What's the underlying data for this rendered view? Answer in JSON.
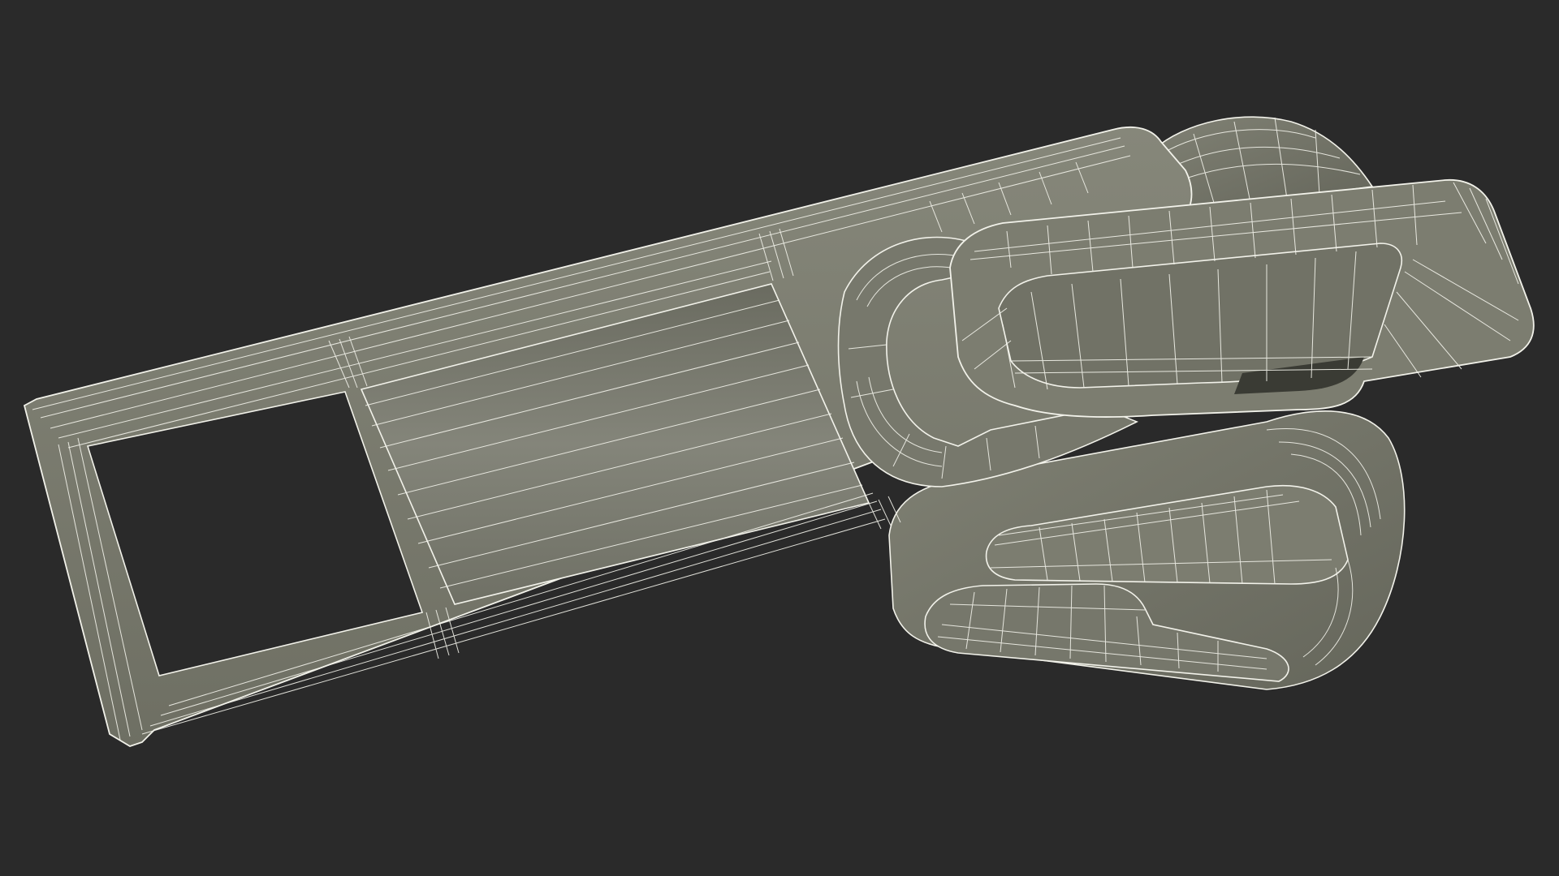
{
  "scene": {
    "subject": "zipper-slider-wireframe-render",
    "colors": {
      "background": "#2a2a2a",
      "surface": "#7a7b6e",
      "surface_light": "#8a8b7e",
      "surface_dark": "#5f6055",
      "shadow": "#3a3b34",
      "wire": "#f2f2ea"
    }
  }
}
